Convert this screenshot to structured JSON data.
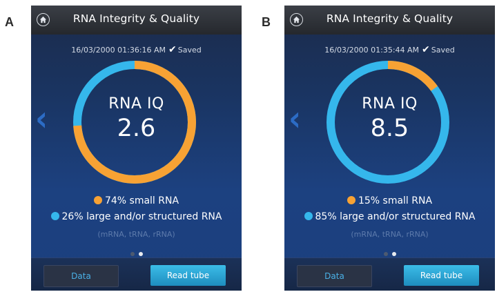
{
  "colors": {
    "small_rna": "#f7a234",
    "large_rna": "#35b7ec"
  },
  "panels": [
    {
      "letter": "A",
      "title": "RNA Integrity & Quality",
      "timestamp": "16/03/2000 01:36:16 AM",
      "status": "Saved",
      "gauge_label": "RNA IQ",
      "score": "2.6",
      "small_fraction": 0.74,
      "large_fraction": 0.26,
      "small_text": "74% small RNA",
      "large_text": "26% large and/or structured RNA",
      "sub_text": "(mRNA, tRNA, rRNA)",
      "page_indicator": {
        "total": 2,
        "current": 2
      },
      "data_button": "Data",
      "read_button": "Read tube"
    },
    {
      "letter": "B",
      "title": "RNA Integrity & Quality",
      "timestamp": "16/03/2000 01:35:44 AM",
      "status": "Saved",
      "gauge_label": "RNA IQ",
      "score": "8.5",
      "small_fraction": 0.15,
      "large_fraction": 0.85,
      "small_text": "15% small RNA",
      "large_text": "85% large and/or structured RNA",
      "sub_text": "(mRNA, tRNA, rRNA)",
      "page_indicator": {
        "total": 2,
        "current": 2
      },
      "data_button": "Data",
      "read_button": "Read tube"
    }
  ]
}
